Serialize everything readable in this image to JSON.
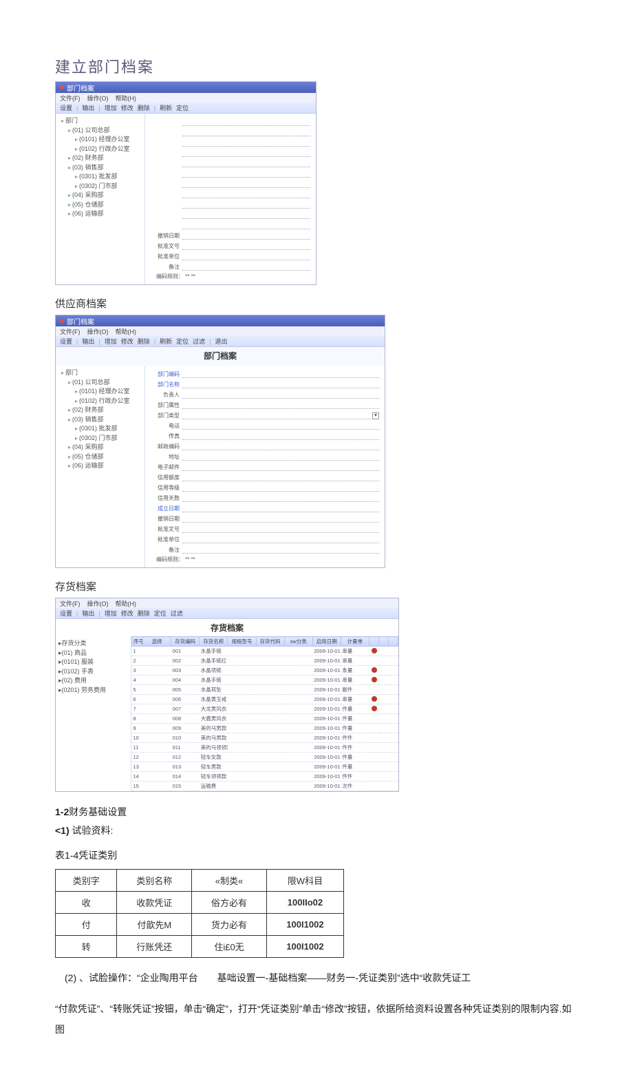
{
  "headings": {
    "h1": "建立部门档案",
    "supplier": "供应商档案",
    "inventory": "存货档案"
  },
  "win_common": {
    "title": "部门档案",
    "menus": [
      "文件(F)",
      "操作(O)",
      "帮助(H)"
    ],
    "tools": [
      "设置",
      "输出",
      "增加",
      "修改",
      "删除",
      "刷新",
      "定位",
      "过滤",
      "退出"
    ],
    "code_format_label": "编码规则：",
    "code_format_value": "** **"
  },
  "tree": [
    {
      "lvl": 1,
      "txt": "部门"
    },
    {
      "lvl": 2,
      "txt": "(01) 公司总部"
    },
    {
      "lvl": 3,
      "txt": "(0101) 经理办公室"
    },
    {
      "lvl": 3,
      "txt": "(0102) 行政办公室"
    },
    {
      "lvl": 2,
      "txt": "(02) 财务部"
    },
    {
      "lvl": 2,
      "txt": "(03) 销售部"
    },
    {
      "lvl": 3,
      "txt": "(0301) 批发部"
    },
    {
      "lvl": 3,
      "txt": "(0302) 门市部"
    },
    {
      "lvl": 2,
      "txt": "(04) 采购部"
    },
    {
      "lvl": 2,
      "txt": "(05) 仓储部"
    },
    {
      "lvl": 2,
      "txt": "(06) 运输部"
    }
  ],
  "form1_labels": [
    "",
    "",
    "",
    "",
    "",
    "",
    "",
    "",
    "",
    "",
    "",
    "撤销日期",
    "批准文号",
    "批准单位",
    "备注"
  ],
  "form2_title": "部门档案",
  "form2_fields": [
    {
      "label": "部门编码",
      "blue": true
    },
    {
      "label": "部门名称",
      "blue": true
    },
    {
      "label": "负责人"
    },
    {
      "label": "部门属性"
    },
    {
      "label": "部门类型",
      "date": true
    },
    {
      "label": "电话"
    },
    {
      "label": "传真"
    },
    {
      "label": "邮政编码"
    },
    {
      "label": "地址"
    },
    {
      "label": "电子邮件"
    },
    {
      "label": "信用额度"
    },
    {
      "label": "信用等级"
    },
    {
      "label": "信用天数"
    },
    {
      "label": "成立日期",
      "blue": true
    },
    {
      "label": "撤销日期"
    },
    {
      "label": "批准文号"
    },
    {
      "label": "批准单位"
    },
    {
      "label": "备注"
    }
  ],
  "inv": {
    "title": "存货档案",
    "tree": [
      {
        "lvl": 1,
        "txt": "存货分类"
      },
      {
        "lvl": 2,
        "txt": "(01) 商品"
      },
      {
        "lvl": 3,
        "txt": "(0101) 服装"
      },
      {
        "lvl": 3,
        "txt": "(0102) 手表"
      },
      {
        "lvl": 2,
        "txt": "(02) 费用"
      },
      {
        "lvl": 3,
        "txt": "(0201) 劳务费用"
      }
    ],
    "cols": [
      "序号",
      "选择",
      "存货编码",
      "存货名称",
      "规格型号",
      "存货代码",
      "sw分类",
      "启用日期",
      "计量单",
      "",
      "",
      ""
    ],
    "rows": [
      {
        "no": 1,
        "code": "001",
        "name": "水晶手链",
        "date": "2009-10-01",
        "unit": "串量",
        "f": 1
      },
      {
        "no": 2,
        "code": "002",
        "name": "水晶手链红",
        "date": "2009-10-01",
        "unit": "串量",
        "f": 0
      },
      {
        "no": 3,
        "code": "003",
        "name": "水晶项链",
        "date": "2009-10-01",
        "unit": "条量",
        "f": 1
      },
      {
        "no": 4,
        "code": "004",
        "name": "水晶手链",
        "date": "2009-10-01",
        "unit": "串量",
        "f": 1
      },
      {
        "no": 5,
        "code": "005",
        "name": "水晶耳坠",
        "date": "2009-10-01",
        "unit": "副件",
        "f": 0
      },
      {
        "no": 6,
        "code": "006",
        "name": "水晶黄玉戒",
        "date": "2009-10-01",
        "unit": "串量",
        "f": 1
      },
      {
        "no": 7,
        "code": "007",
        "name": "大龙男风衣",
        "date": "2009-10-01",
        "unit": "件量",
        "f": 1
      },
      {
        "no": 8,
        "code": "008",
        "name": "大鹿男风衣",
        "date": "2009-10-01",
        "unit": "件量",
        "f": 0
      },
      {
        "no": 9,
        "code": "009",
        "name": "美的马男款",
        "date": "2009-10-01",
        "unit": "件量",
        "f": 0
      },
      {
        "no": 10,
        "code": "010",
        "name": "美的马男款",
        "date": "2009-10-01",
        "unit": "件件",
        "f": 0
      },
      {
        "no": 11,
        "code": "011",
        "name": "美的马领领款",
        "date": "2009-10-01",
        "unit": "件件",
        "f": 0
      },
      {
        "no": 12,
        "code": "012",
        "name": "轻车女款",
        "date": "2009-10-01",
        "unit": "件量",
        "f": 0
      },
      {
        "no": 13,
        "code": "013",
        "name": "轻车男款",
        "date": "2009-10-01",
        "unit": "件量",
        "f": 0
      },
      {
        "no": 14,
        "code": "014",
        "name": "轻车领领款",
        "date": "2009-10-01",
        "unit": "件件",
        "f": 0
      },
      {
        "no": 15,
        "code": "015",
        "name": "运输费",
        "date": "2009-10-01",
        "unit": "次件",
        "f": 0
      }
    ]
  },
  "section": {
    "line1a": "1-2",
    "line1b": "财务基础设置",
    "line2a": "<1)",
    "line2b": " 试验资料:",
    "tableTitle": "表1-4凭证类别"
  },
  "vt": {
    "head": [
      "类别字",
      "类别名称",
      "«制类«",
      "限W科目"
    ],
    "rows": [
      [
        "收",
        "收款凭证",
        "俗方必有",
        "100IIo02"
      ],
      [
        "付",
        "付歆先M",
        "货力必有",
        "100I1002"
      ],
      [
        "转",
        "行账凭还",
        "住i£0无",
        "100I1002"
      ]
    ]
  },
  "para": {
    "p1": "(2) 、试脸操作：“企业陶用平台　　基咄设置一-基础档案——财务一-凭证类别”选中“收款凭证工",
    "p2": "“付款凭证”、“转账凭证”按钿，单击“确定”，打开“凭证类别”单击“修改”按钮，依据所给资料设置各种凭证类别的限制内容.如图"
  }
}
